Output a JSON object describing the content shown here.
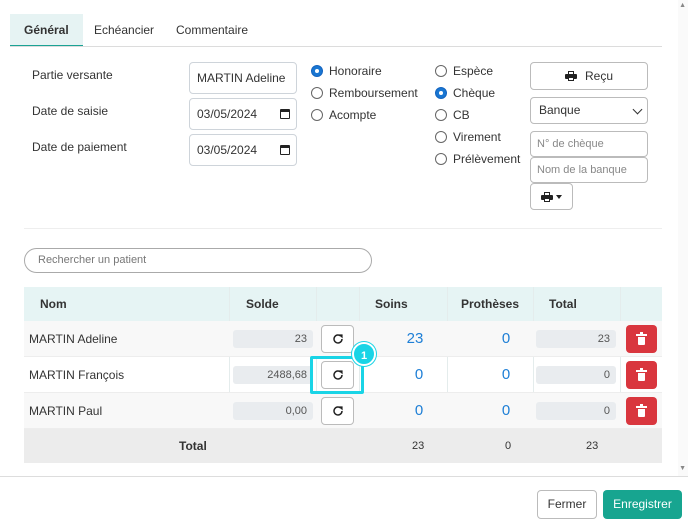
{
  "tabs": [
    {
      "label": "Général",
      "active": true
    },
    {
      "label": "Echéancier",
      "active": false
    },
    {
      "label": "Commentaire",
      "active": false
    }
  ],
  "form": {
    "partie_versante_label": "Partie versante",
    "partie_versante_value": "MARTIN  Adeline",
    "date_saisie_label": "Date de saisie",
    "date_saisie_value": "03/05/2024",
    "date_paiement_label": "Date de paiement",
    "date_paiement_value": "03/05/2024"
  },
  "type_options": [
    {
      "label": "Honoraire",
      "checked": true
    },
    {
      "label": "Remboursement",
      "checked": false
    },
    {
      "label": "Acompte",
      "checked": false
    }
  ],
  "mode_options": [
    {
      "label": "Espèce",
      "checked": false
    },
    {
      "label": "Chèque",
      "checked": true
    },
    {
      "label": "CB",
      "checked": false
    },
    {
      "label": "Virement",
      "checked": false
    },
    {
      "label": "Prélèvement",
      "checked": false
    }
  ],
  "right_panel": {
    "recu_label": "Reçu",
    "banque_select": "Banque",
    "cheque_placeholder": "N° de chèque",
    "banque_name_placeholder": "Nom de la banque"
  },
  "search": {
    "placeholder": "Rechercher un patient"
  },
  "table": {
    "headers": {
      "nom": "Nom",
      "solde": "Solde",
      "soins": "Soins",
      "protheses": "Prothèses",
      "total": "Total"
    },
    "rows": [
      {
        "nom": "MARTIN Adeline",
        "solde": "23",
        "soins": "23",
        "protheses": "0",
        "total": "23"
      },
      {
        "nom": "MARTIN François",
        "solde": "2488,68",
        "soins": "0",
        "protheses": "0",
        "total": "0"
      },
      {
        "nom": "MARTIN Paul",
        "solde": "0,00",
        "soins": "0",
        "protheses": "0",
        "total": "0"
      }
    ],
    "footer": {
      "label": "Total",
      "soins": "23",
      "protheses": "0",
      "total": "23"
    }
  },
  "annotation": {
    "step": "1",
    "color": "#19d4e6"
  },
  "footer": {
    "fermer": "Fermer",
    "enregistrer": "Enregistrer"
  },
  "colors": {
    "accent": "#17a590",
    "danger": "#d9363e",
    "link": "#1e7fd6",
    "radio": "#1976d2"
  }
}
